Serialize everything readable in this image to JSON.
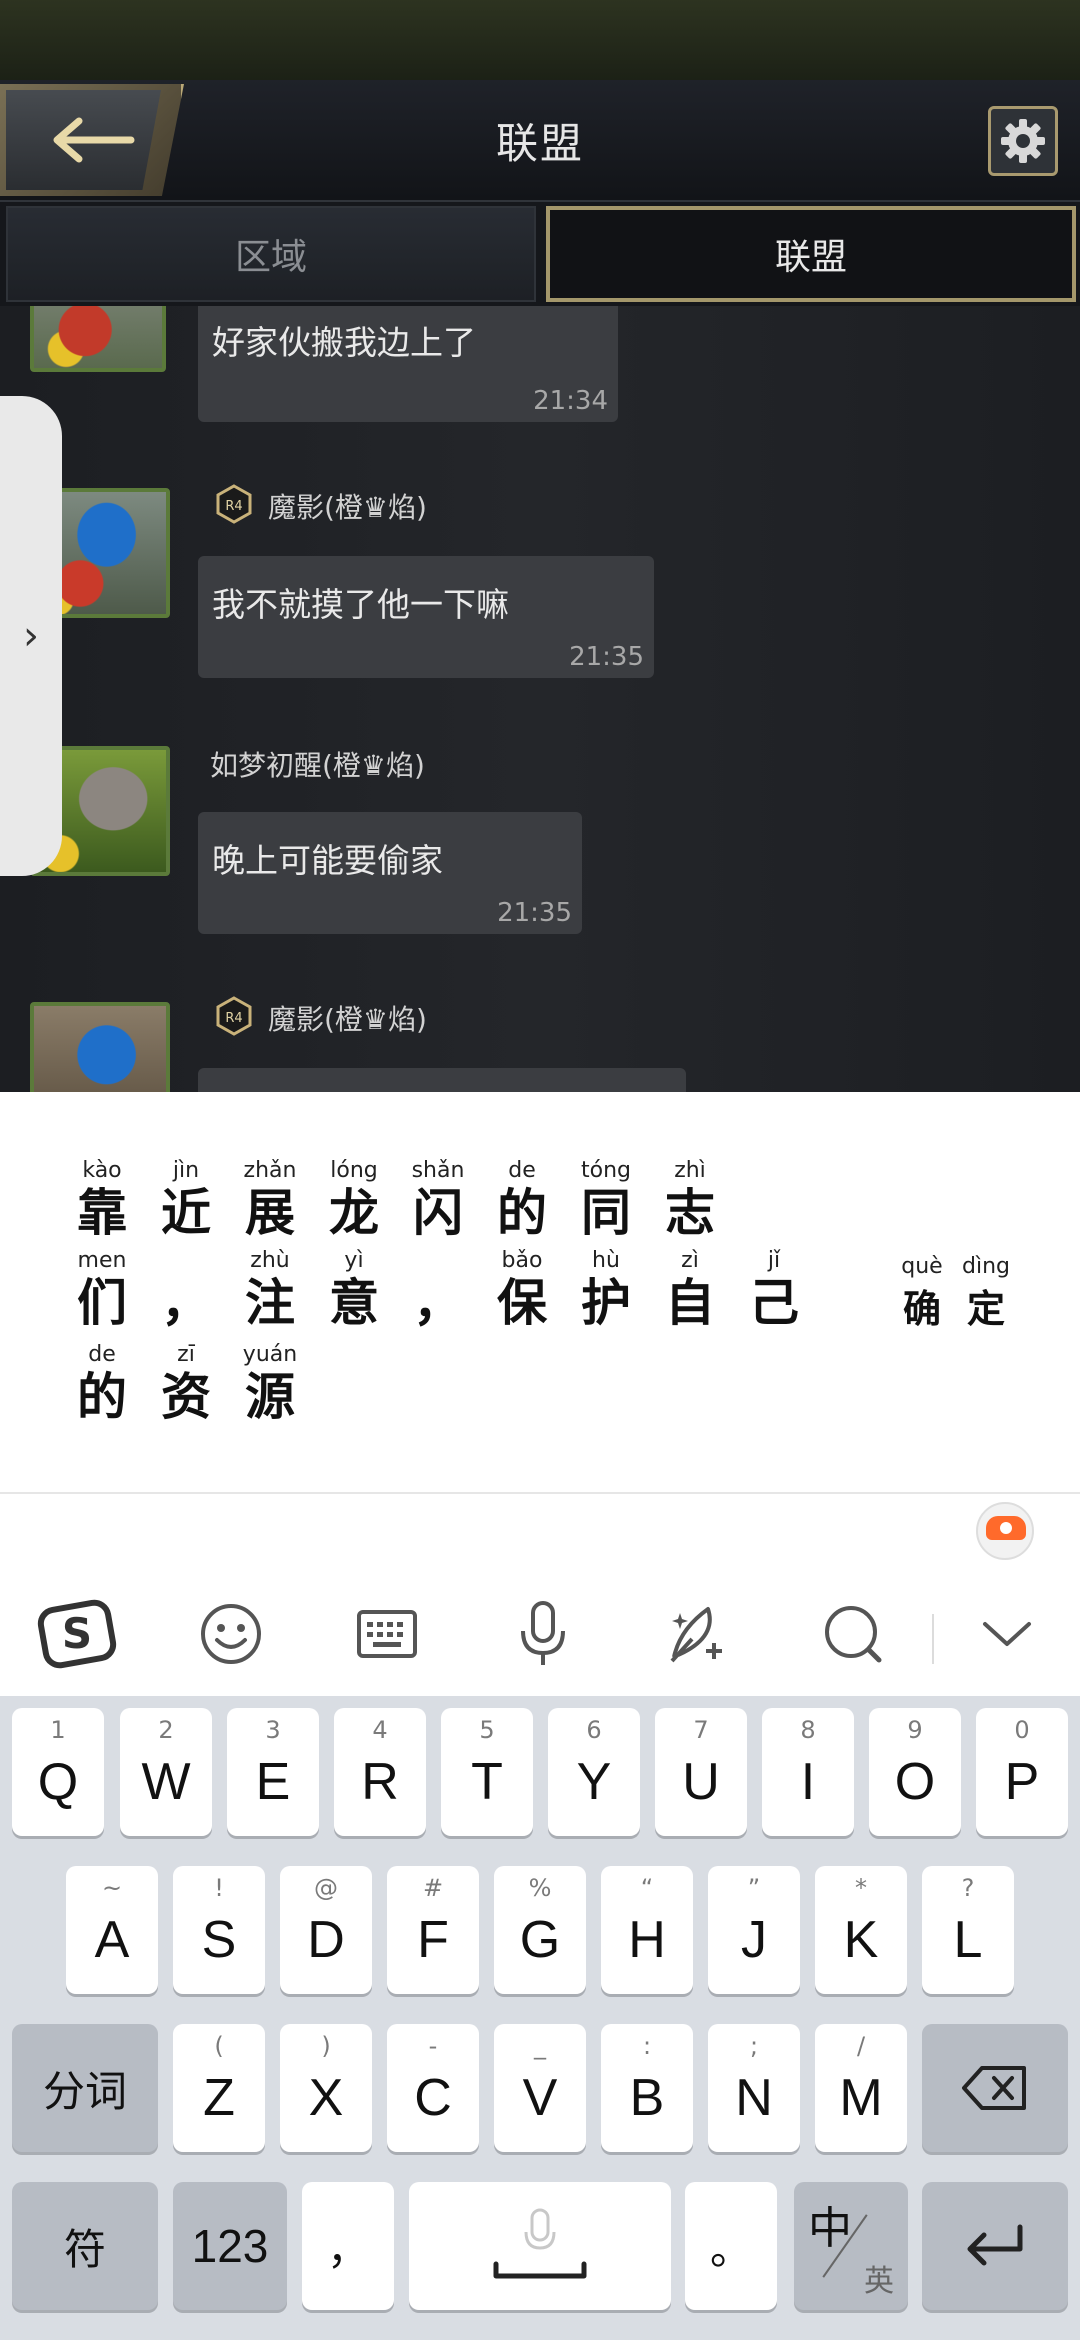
{
  "game": {
    "title": "联盟",
    "tabs": [
      {
        "label": "区域",
        "active": false
      },
      {
        "label": "联盟",
        "active": true
      }
    ],
    "messages": [
      {
        "text": "好家伙搬我边上了",
        "time": "21:34"
      },
      {
        "sender": "魔影(橙♛焰)",
        "rank": "R4",
        "text": "我不就摸了他一下嘛",
        "time": "21:35"
      },
      {
        "sender": "如梦初醒(橙♛焰)",
        "text": "晚上可能要偷家",
        "time": "21:35"
      },
      {
        "sender": "魔影(橙♛焰)",
        "rank": "R4"
      }
    ]
  },
  "ime": {
    "candidates": [
      {
        "py": "kào",
        "hz": "靠"
      },
      {
        "py": "jìn",
        "hz": "近"
      },
      {
        "py": "zhǎn",
        "hz": "展"
      },
      {
        "py": "lóng",
        "hz": "龙"
      },
      {
        "py": "shǎn",
        "hz": "闪"
      },
      {
        "py": "de",
        "hz": "的"
      },
      {
        "py": "tóng",
        "hz": "同"
      },
      {
        "py": "zhì",
        "hz": "志"
      },
      {
        "py": "men",
        "hz": "们"
      },
      {
        "py": "",
        "hz": "，"
      },
      {
        "py": "zhù",
        "hz": "注"
      },
      {
        "py": "yì",
        "hz": "意"
      },
      {
        "py": "",
        "hz": "，"
      },
      {
        "py": "bǎo",
        "hz": "保"
      },
      {
        "py": "hù",
        "hz": "护"
      },
      {
        "py": "zì",
        "hz": "自"
      },
      {
        "py": "jǐ",
        "hz": "己"
      },
      {
        "py": "de",
        "hz": "的"
      },
      {
        "py": "zī",
        "hz": "资"
      },
      {
        "py": "yuán",
        "hz": "源"
      }
    ],
    "confirm": [
      {
        "py": "què",
        "hz": "确"
      },
      {
        "py": "dìng",
        "hz": "定"
      }
    ],
    "toolbar": [
      "sogou-logo-icon",
      "emoji-icon",
      "keyboard-icon",
      "microphone-icon",
      "handwriting-icon",
      "search-icon",
      "collapse-chevron-icon"
    ],
    "keys": {
      "row1": [
        {
          "sub": "1",
          "main": "Q"
        },
        {
          "sub": "2",
          "main": "W"
        },
        {
          "sub": "3",
          "main": "E"
        },
        {
          "sub": "4",
          "main": "R"
        },
        {
          "sub": "5",
          "main": "T"
        },
        {
          "sub": "6",
          "main": "Y"
        },
        {
          "sub": "7",
          "main": "U"
        },
        {
          "sub": "8",
          "main": "I"
        },
        {
          "sub": "9",
          "main": "O"
        },
        {
          "sub": "0",
          "main": "P"
        }
      ],
      "row2": [
        {
          "sub": "~",
          "main": "A"
        },
        {
          "sub": "!",
          "main": "S"
        },
        {
          "sub": "@",
          "main": "D"
        },
        {
          "sub": "#",
          "main": "F"
        },
        {
          "sub": "%",
          "main": "G"
        },
        {
          "sub": "“",
          "main": "H"
        },
        {
          "sub": "”",
          "main": "J"
        },
        {
          "sub": "*",
          "main": "K"
        },
        {
          "sub": "?",
          "main": "L"
        }
      ],
      "row3": [
        {
          "sub": "(",
          "main": "Z"
        },
        {
          "sub": ")",
          "main": "X"
        },
        {
          "sub": "-",
          "main": "C"
        },
        {
          "sub": "_",
          "main": "V"
        },
        {
          "sub": ":",
          "main": "B"
        },
        {
          "sub": ";",
          "main": "N"
        },
        {
          "sub": "/",
          "main": "M"
        }
      ],
      "split_word": "分词",
      "symbols": "符",
      "numbers": "123",
      "comma": "，",
      "period": "。",
      "lang_main": "中",
      "lang_sub": "英"
    }
  }
}
